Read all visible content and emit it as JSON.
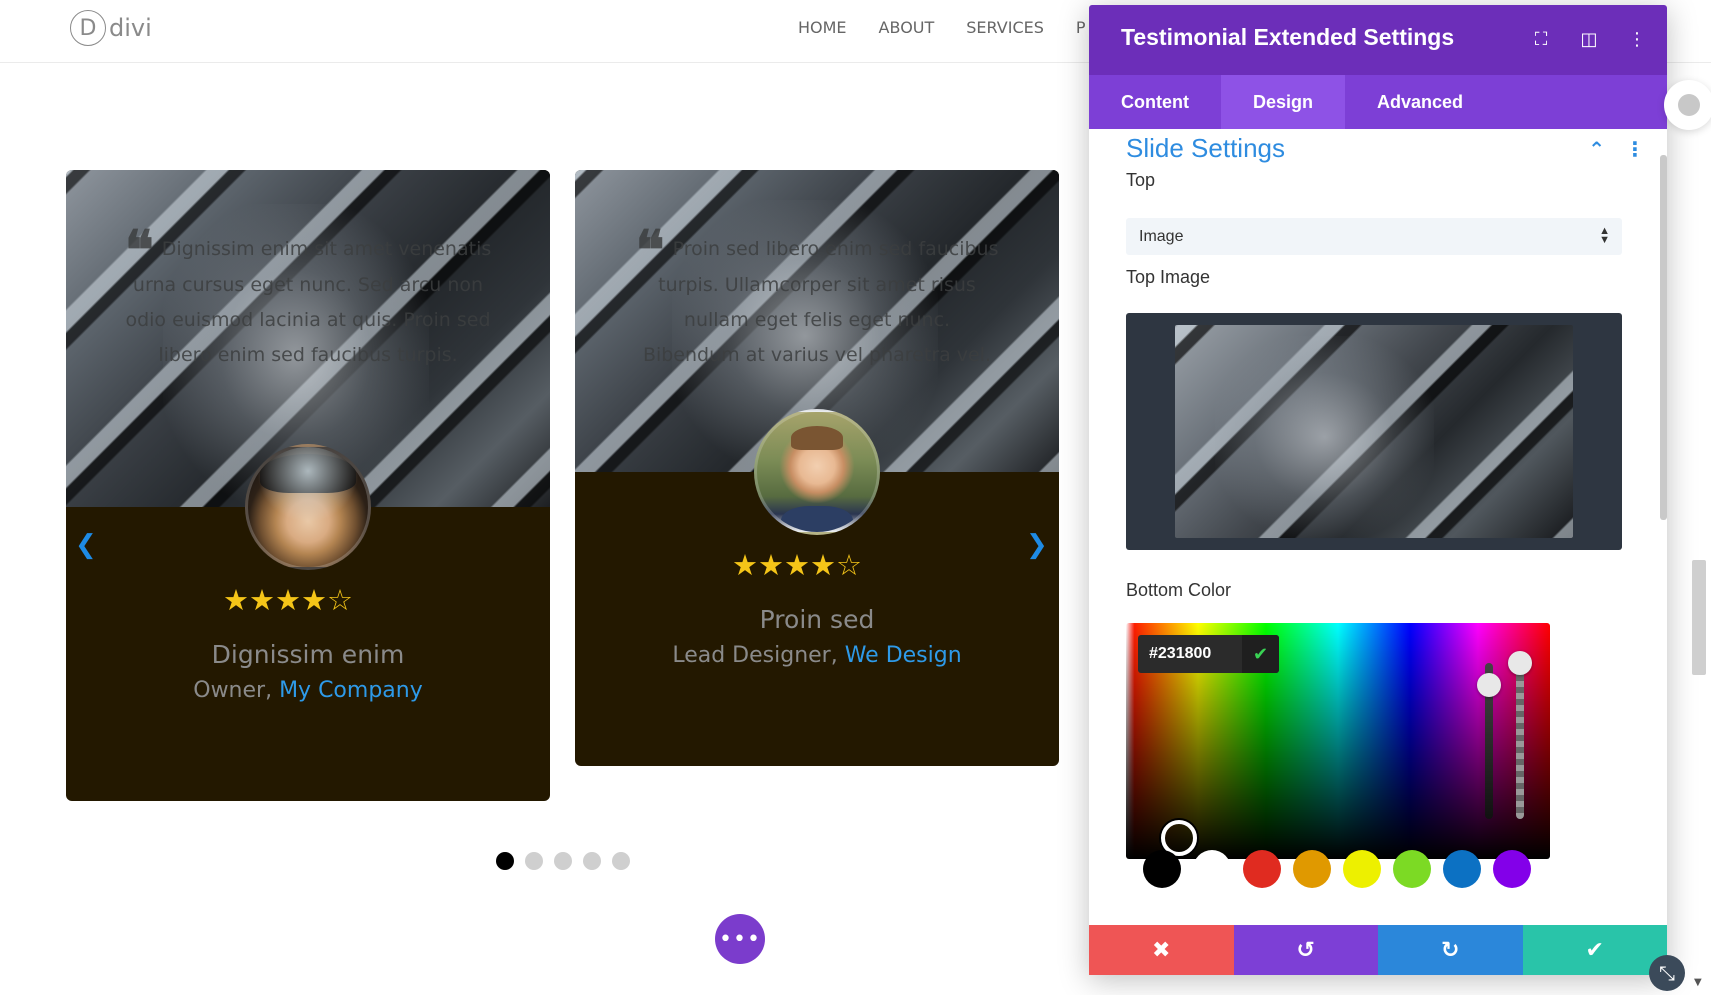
{
  "site": {
    "logo_mark": "D",
    "logo_text": "divi",
    "nav": [
      "HOME",
      "ABOUT",
      "SERVICES",
      "P"
    ]
  },
  "testimonials": [
    {
      "quote_mark": "❝",
      "quote": "Dignissim enim sit amet venenatis urna cursus eget nunc. Sed arcu non odio euismod lacinia at quis. Proin sed libero enim sed faucibus turpis.",
      "rating": 4,
      "stars": "★★★★☆",
      "name": "Dignissim enim",
      "role": "Owner, ",
      "company": "My Company"
    },
    {
      "quote_mark": "❝",
      "quote": "Proin sed libero enim sed faucibus turpis. Ullamcorper sit amet risus nullam eget felis eget nunc. Bibendum at varius vel pharetra vel.",
      "rating": 4,
      "stars": "★★★★☆",
      "name": "Proin sed",
      "role": "Lead Designer, ",
      "company": "We Design"
    }
  ],
  "carousel": {
    "prev_arrow": "❮",
    "next_arrow": "❯",
    "dot_count": 5,
    "active_dot": 0,
    "fab_label": "•••"
  },
  "panel": {
    "title": "Testimonial Extended Settings",
    "header_icons": [
      "focus-icon",
      "layout-icon",
      "more-icon"
    ],
    "header_glyphs": [
      "⛶",
      "◫",
      "⋮"
    ],
    "tabs": [
      "Content",
      "Design",
      "Advanced"
    ],
    "active_tab": "Design",
    "section_title": "Slide Settings",
    "section_collapse": "⌃",
    "section_more": "⋮",
    "top_label": "Top",
    "top_value": "Image",
    "top_image_label": "Top Image",
    "bottom_color_label": "Bottom Color",
    "bottom_color_hex": "#231800",
    "confirm_glyph": "✔",
    "swatches": [
      "#000000",
      "#ffffff",
      "#e02b20",
      "#e09900",
      "#edf000",
      "#7cda24",
      "#0c71c3",
      "#8300e9"
    ]
  },
  "actions": [
    {
      "name": "cancel",
      "glyph": "✖",
      "color": "#ef5555"
    },
    {
      "name": "undo",
      "glyph": "↺",
      "color": "#7d3fd6"
    },
    {
      "name": "redo",
      "glyph": "↻",
      "color": "#2b87da"
    },
    {
      "name": "save",
      "glyph": "✔",
      "color": "#29c4a9"
    }
  ],
  "colors": {
    "card_bottom": "#231800",
    "panel_header": "#6c2eb9",
    "tabs_bar": "#7d3fd6",
    "accent_blue": "#2e8ce0",
    "star": "#f5c518"
  }
}
